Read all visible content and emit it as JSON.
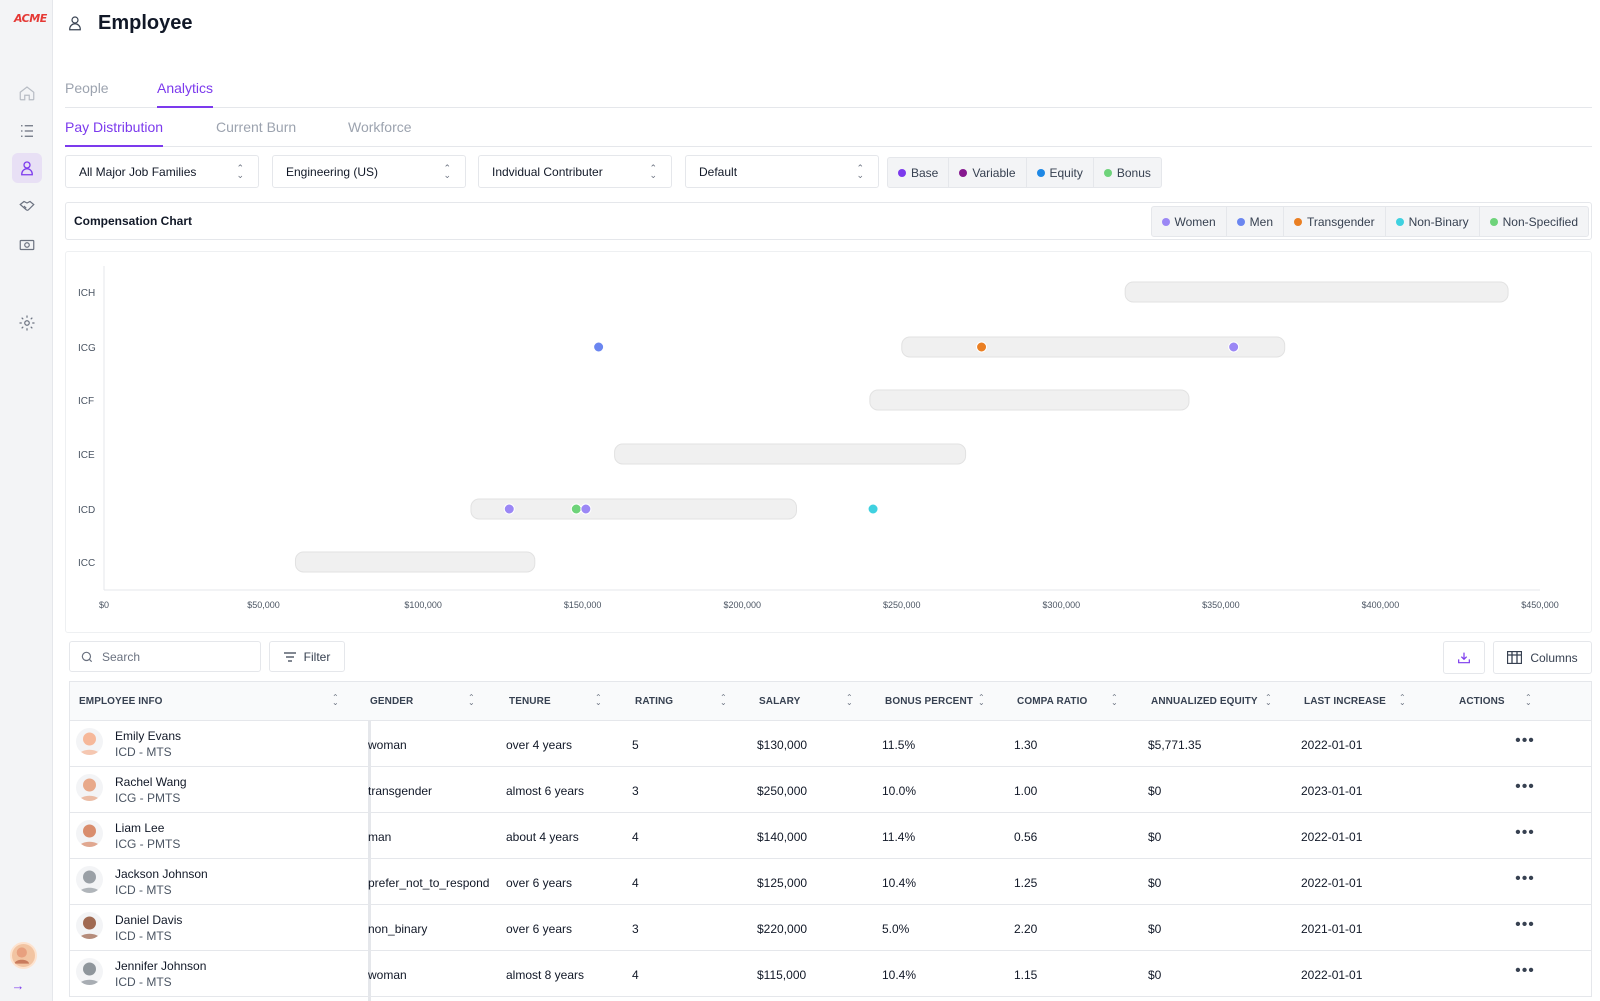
{
  "app": {
    "logo_text": "ACME",
    "page_title": "Employee"
  },
  "sidebar": {
    "items": [
      {
        "icon": "home-icon"
      },
      {
        "icon": "list-icon"
      },
      {
        "icon": "user-icon",
        "active": true
      },
      {
        "icon": "handshake-icon"
      },
      {
        "icon": "money-icon"
      },
      {
        "icon": "gear-icon"
      }
    ]
  },
  "tabs": {
    "main": [
      "People",
      "Analytics"
    ],
    "main_active": "Analytics",
    "sub": [
      "Pay Distribution",
      "Current Burn",
      "Workforce"
    ],
    "sub_active": "Pay Distribution"
  },
  "filters": {
    "job_family": "All Major Job Families",
    "department": "Engineering (US)",
    "track": "Indvidual Contributer",
    "view": "Default"
  },
  "compensation_types": [
    {
      "label": "Base",
      "color": "#7c3aed"
    },
    {
      "label": "Variable",
      "color": "#86198f"
    },
    {
      "label": "Equity",
      "color": "#1e88e5"
    },
    {
      "label": "Bonus",
      "color": "#6ed37a"
    }
  ],
  "chart_header": {
    "title": "Compensation Chart"
  },
  "legend": [
    {
      "label": "Women",
      "color": "#9b87f5"
    },
    {
      "label": "Men",
      "color": "#6b86f0"
    },
    {
      "label": "Transgender",
      "color": "#ea7f23"
    },
    {
      "label": "Non-Binary",
      "color": "#3fd1e0"
    },
    {
      "label": "Non-Specified",
      "color": "#6ed37a"
    }
  ],
  "chart_data": {
    "type": "scatter",
    "title": "Compensation Chart",
    "x_ticks": [
      "$0",
      "$50,000",
      "$100,000",
      "$150,000",
      "$200,000",
      "$250,000",
      "$300,000",
      "$350,000",
      "$400,000",
      "$450,000"
    ],
    "xlim": [
      0,
      450000
    ],
    "levels": [
      "ICH",
      "ICG",
      "ICF",
      "ICE",
      "ICD",
      "ICC"
    ],
    "ranges": [
      {
        "level": "ICH",
        "min": 320000,
        "max": 440000
      },
      {
        "level": "ICG",
        "min": 250000,
        "max": 370000
      },
      {
        "level": "ICF",
        "min": 240000,
        "max": 340000
      },
      {
        "level": "ICE",
        "min": 160000,
        "max": 270000
      },
      {
        "level": "ICD",
        "min": 115000,
        "max": 217000
      },
      {
        "level": "ICC",
        "min": 60000,
        "max": 135000
      }
    ],
    "points": [
      {
        "level": "ICG",
        "x": 155000,
        "gender": "Men"
      },
      {
        "level": "ICG",
        "x": 275000,
        "gender": "Transgender"
      },
      {
        "level": "ICG",
        "x": 354000,
        "gender": "Women"
      },
      {
        "level": "ICD",
        "x": 127000,
        "gender": "Women"
      },
      {
        "level": "ICD",
        "x": 148000,
        "gender": "Non-Specified"
      },
      {
        "level": "ICD",
        "x": 151000,
        "gender": "Women"
      },
      {
        "level": "ICD",
        "x": 241000,
        "gender": "Non-Binary"
      }
    ]
  },
  "toolbar": {
    "search_placeholder": "Search",
    "filter_label": "Filter",
    "columns_label": "Columns"
  },
  "table": {
    "headers": [
      "EMPLOYEE INFO",
      "GENDER",
      "TENURE",
      "RATING",
      "SALARY",
      "BONUS PERCENT",
      "COMPA RATIO",
      "ANNUALIZED EQUITY",
      "LAST INCREASE",
      "ACTIONS"
    ],
    "rows": [
      {
        "name": "Emily Evans",
        "role": "ICD - MTS",
        "gender": "woman",
        "tenure": "over 4 years",
        "rating": "5",
        "salary": "$130,000",
        "bonus": "11.5%",
        "compa": "1.30",
        "equity": "$5,771.35",
        "last_increase": "2022-01-01",
        "avatar": "#f6b89a"
      },
      {
        "name": "Rachel Wang",
        "role": "ICG - PMTS",
        "gender": "transgender",
        "tenure": "almost 6 years",
        "rating": "3",
        "salary": "$250,000",
        "bonus": "10.0%",
        "compa": "1.00",
        "equity": "$0",
        "last_increase": "2023-01-01",
        "avatar": "#e8a98a"
      },
      {
        "name": "Liam Lee",
        "role": "ICG - PMTS",
        "gender": "man",
        "tenure": "about 4 years",
        "rating": "4",
        "salary": "$140,000",
        "bonus": "11.4%",
        "compa": "0.56",
        "equity": "$0",
        "last_increase": "2022-01-01",
        "avatar": "#d98d6d"
      },
      {
        "name": "Jackson Johnson",
        "role": "ICD - MTS",
        "gender": "prefer_not_to_respond",
        "tenure": "over 6 years",
        "rating": "4",
        "salary": "$125,000",
        "bonus": "10.4%",
        "compa": "1.25",
        "equity": "$0",
        "last_increase": "2022-01-01",
        "avatar": "#9aa0a6"
      },
      {
        "name": "Daniel Davis",
        "role": "ICD - MTS",
        "gender": "non_binary",
        "tenure": "over 6 years",
        "rating": "3",
        "salary": "$220,000",
        "bonus": "5.0%",
        "compa": "2.20",
        "equity": "$0",
        "last_increase": "2021-01-01",
        "avatar": "#a06a52"
      },
      {
        "name": "Jennifer Johnson",
        "role": "ICD - MTS",
        "gender": "woman",
        "tenure": "almost 8 years",
        "rating": "4",
        "salary": "$115,000",
        "bonus": "10.4%",
        "compa": "1.15",
        "equity": "$0",
        "last_increase": "2022-01-01",
        "avatar": "#8f969c"
      }
    ],
    "actions_label": "•••"
  }
}
